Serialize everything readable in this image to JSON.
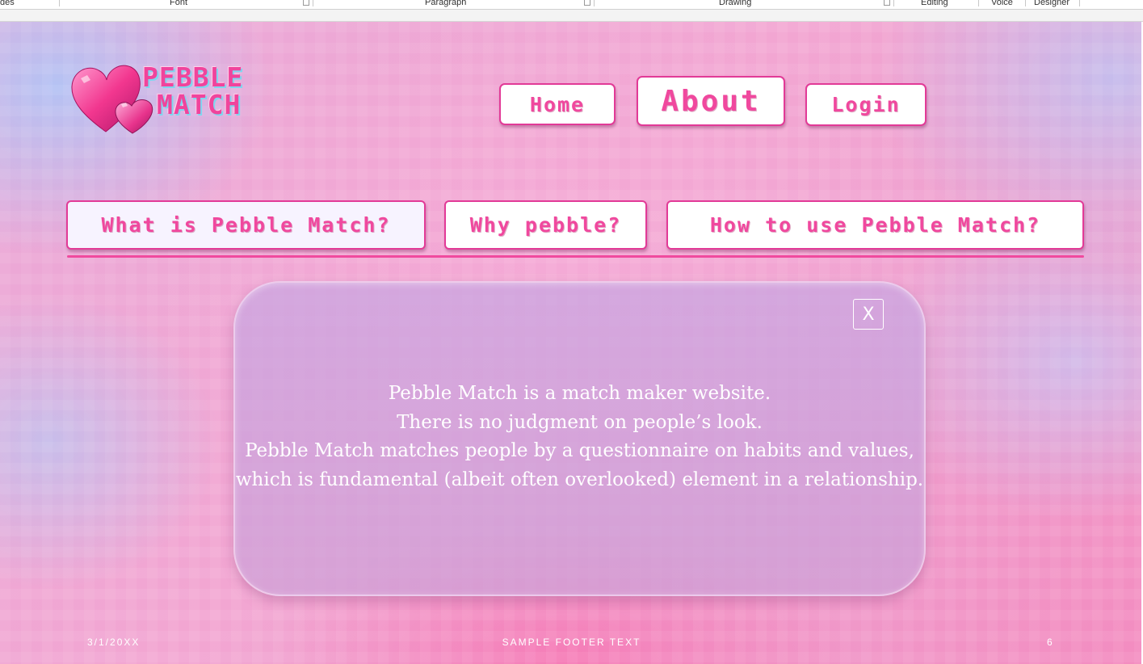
{
  "ribbon": {
    "groups": [
      "des",
      "Font",
      "Paragraph",
      "Drawing",
      "Editing",
      "Voice",
      "Designer"
    ]
  },
  "logo": {
    "line1": "PEBBLE",
    "line2": "MATCH",
    "icon": "hearts-icon"
  },
  "nav": {
    "home": "Home",
    "about": "About",
    "login": "Login"
  },
  "sections": {
    "what": "What is Pebble Match?",
    "why": "Why pebble?",
    "how": "How to use Pebble Match?"
  },
  "panel": {
    "close_label": "X",
    "lines": [
      "Pebble Match is a match maker website.",
      "There is no judgment on people’s look.",
      "Pebble Match matches people by a questionnaire on habits and values,",
      "which is fundamental (albeit often overlooked) element in a relationship."
    ]
  },
  "footer": {
    "date": "3/1/20XX",
    "center": "SAMPLE FOOTER TEXT",
    "page": "6"
  },
  "colors": {
    "accent": "#f0489e",
    "border": "#e23a97",
    "panel": "#c8a5e1"
  }
}
